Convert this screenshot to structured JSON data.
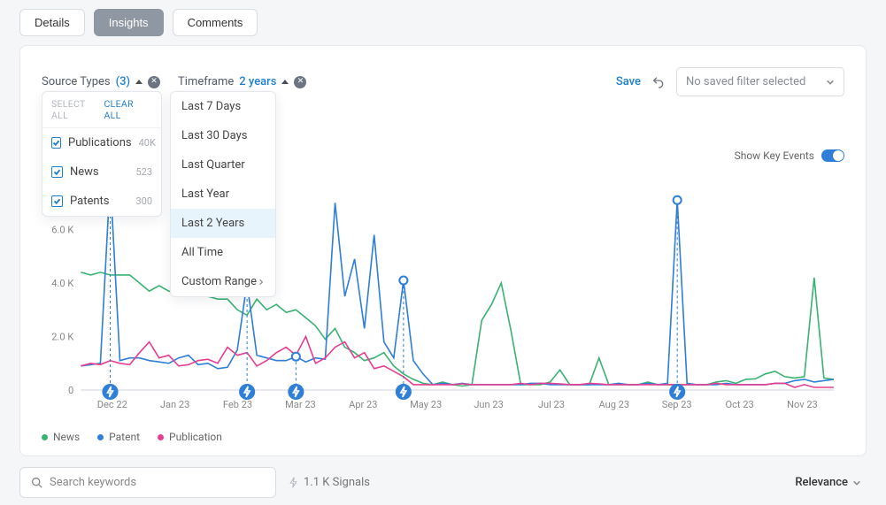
{
  "tabs": {
    "details": "Details",
    "insights": "Insights",
    "comments": "Comments"
  },
  "filters": {
    "source_types_label": "Source Types",
    "source_types_count": "(3)",
    "timeframe_label": "Timeframe",
    "timeframe_value": "2 years",
    "save_label": "Save",
    "saved_filter_placeholder": "No saved filter selected"
  },
  "source_types_dd": {
    "select_all": "SELECT ALL",
    "clear_all": "CLEAR ALL",
    "items": [
      {
        "label": "Publications",
        "count": "40K"
      },
      {
        "label": "News",
        "count": "523"
      },
      {
        "label": "Patents",
        "count": "300"
      }
    ]
  },
  "timeframe_dd": {
    "options": [
      "Last 7 Days",
      "Last 30 Days",
      "Last Quarter",
      "Last Year",
      "Last 2 Years",
      "All Time",
      "Custom Range"
    ],
    "selected_index": 4
  },
  "key_events_label": "Show Key Events",
  "legend": [
    "News",
    "Patent",
    "Publication"
  ],
  "bottom": {
    "search_placeholder": "Search keywords",
    "signals": "1.1 K Signals",
    "sort_label": "Relevance"
  },
  "chart_data": {
    "type": "line",
    "xlabel": "",
    "ylabel": "",
    "ylim": [
      0,
      8000
    ],
    "y_ticks": [
      "0",
      "2.0 K",
      "4.0 K",
      "6.0 K"
    ],
    "categories": [
      "Dec 22",
      "Jan 23",
      "Feb 23",
      "Mar 23",
      "Apr 23",
      "May 23",
      "Jun 23",
      "Jul 23",
      "Aug 23",
      "Sep 23",
      "Oct 23",
      "Nov 23"
    ],
    "series": [
      {
        "name": "News",
        "color": "#3bb273",
        "values": [
          4400,
          4300,
          4400,
          4300,
          4300,
          4300,
          4000,
          3700,
          3900,
          3700,
          3600,
          3700,
          3700,
          3500,
          3400,
          3400,
          3000,
          2800,
          3400,
          3000,
          3200,
          2900,
          3000,
          2700,
          2400,
          1900,
          2300,
          1600,
          1400,
          1100,
          1200,
          1400,
          900,
          600,
          400,
          250,
          200,
          300,
          200,
          150,
          200,
          2600,
          3200,
          4000,
          2200,
          200,
          200,
          200,
          300,
          750,
          200,
          200,
          200,
          1200,
          200,
          200,
          200,
          200,
          300,
          200,
          200,
          200,
          200,
          200,
          200,
          300,
          350,
          250,
          400,
          420,
          600,
          700,
          500,
          450,
          500,
          4200,
          450,
          400
        ]
      },
      {
        "name": "Patent",
        "color": "#2f7ed8",
        "values": [
          900,
          950,
          1000,
          7900,
          1100,
          1200,
          1200,
          1100,
          1050,
          1000,
          1200,
          1300,
          950,
          1000,
          800,
          850,
          1500,
          4000,
          1300,
          1200,
          1100,
          1100,
          1250,
          1050,
          1200,
          1150,
          7000,
          3500,
          4900,
          2300,
          5800,
          1800,
          1200,
          4100,
          1100,
          600,
          200,
          250,
          200,
          250,
          200,
          200,
          200,
          200,
          200,
          200,
          250,
          250,
          200,
          200,
          200,
          200,
          200,
          200,
          200,
          250,
          200,
          200,
          250,
          200,
          250,
          7100,
          250,
          200,
          200,
          200,
          250,
          200,
          200,
          200,
          200,
          250,
          250,
          350,
          400,
          300,
          350,
          400
        ]
      },
      {
        "name": "Publication",
        "color": "#e53f92",
        "values": [
          900,
          1000,
          950,
          1100,
          1000,
          950,
          1400,
          1800,
          1200,
          1300,
          900,
          950,
          1100,
          1150,
          1000,
          1600,
          1300,
          1400,
          900,
          1100,
          1400,
          1600,
          1300,
          2000,
          1000,
          1200,
          1600,
          1800,
          1200,
          1400,
          800,
          900,
          700,
          500,
          200,
          200,
          200,
          200,
          200,
          230,
          200,
          200,
          200,
          200,
          200,
          250,
          200,
          250,
          250,
          230,
          200,
          200,
          250,
          230,
          200,
          200,
          200,
          200,
          200,
          200,
          200,
          200,
          200,
          200,
          200,
          250,
          200,
          200,
          200,
          200,
          200,
          250,
          250,
          100,
          200,
          100,
          100,
          100
        ]
      }
    ],
    "key_event_markers_x": [
      3,
      17,
      22,
      33,
      61
    ],
    "key_event_ring_y": [
      7900,
      4000,
      1250,
      4100,
      7100
    ]
  }
}
